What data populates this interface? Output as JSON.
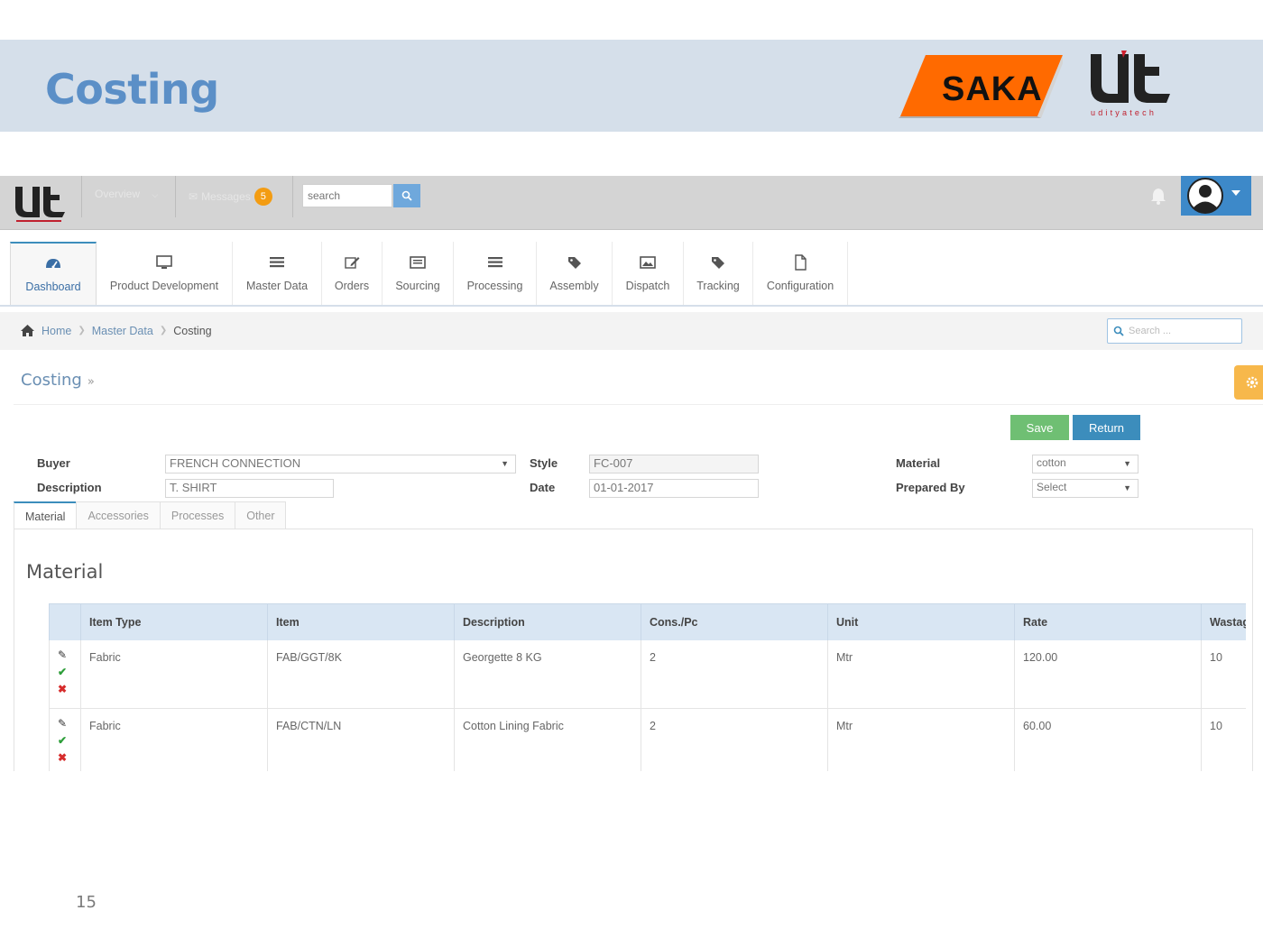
{
  "slide": {
    "title": "Costing",
    "logo_saka": "SAKA",
    "logo_ut_tagline": "udityatech",
    "page_number": "15"
  },
  "topbar": {
    "overview_label": "Overview",
    "messages_label": "Messages",
    "messages_count": "5",
    "search_placeholder": "search"
  },
  "nav": {
    "items": [
      {
        "label": "Dashboard",
        "icon": "dashboard-icon"
      },
      {
        "label": "Product Development",
        "icon": "monitor-icon"
      },
      {
        "label": "Master Data",
        "icon": "list-icon"
      },
      {
        "label": "Orders",
        "icon": "edit-icon"
      },
      {
        "label": "Sourcing",
        "icon": "card-icon"
      },
      {
        "label": "Processing",
        "icon": "list-icon"
      },
      {
        "label": "Assembly",
        "icon": "tag-icon"
      },
      {
        "label": "Dispatch",
        "icon": "image-icon"
      },
      {
        "label": "Tracking",
        "icon": "tag-icon"
      },
      {
        "label": "Configuration",
        "icon": "file-icon"
      }
    ],
    "active": "Dashboard"
  },
  "breadcrumb": {
    "home": "Home",
    "master_data": "Master Data",
    "current": "Costing",
    "search_placeholder": "Search ..."
  },
  "page": {
    "title": "Costing",
    "title_suffix": "»",
    "save_label": "Save",
    "return_label": "Return"
  },
  "form": {
    "buyer_label": "Buyer",
    "buyer_value": "FRENCH CONNECTION",
    "description_label": "Description",
    "description_value": "T. SHIRT",
    "style_label": "Style",
    "style_value": "FC-007",
    "date_label": "Date",
    "date_value": "01-01-2017",
    "material_label": "Material",
    "material_value": "cotton",
    "prepared_by_label": "Prepared By",
    "prepared_by_value": "Select"
  },
  "tabs": [
    "Material",
    "Accessories",
    "Processes",
    "Other"
  ],
  "material": {
    "section_title": "Material",
    "columns": [
      "Item Type",
      "Item",
      "Description",
      "Cons./Pc",
      "Unit",
      "Rate",
      "Wastage"
    ],
    "rows": [
      [
        "Fabric",
        "FAB/GGT/8K",
        "Georgette 8 KG",
        "2",
        "Mtr",
        "120.00",
        "10"
      ],
      [
        "Fabric",
        "FAB/CTN/LN",
        "Cotton Lining Fabric",
        "2",
        "Mtr",
        "60.00",
        "10"
      ]
    ]
  },
  "colors": {
    "slide_header_bg": "#d5dfea",
    "slide_title": "#5b8fc7",
    "saka_orange": "#ff6a00",
    "primary_blue": "#3c8dbc",
    "save_green": "#6fbf73",
    "table_header_bg": "#d9e6f3",
    "badge_orange": "#f39c12",
    "gear_tab": "#f7b84b"
  }
}
